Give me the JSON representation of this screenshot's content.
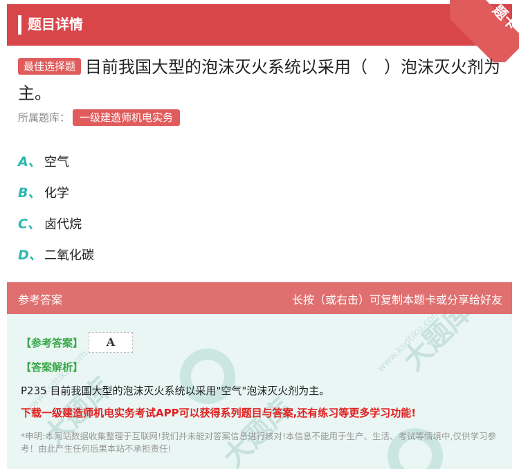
{
  "header": {
    "title": "题目详情",
    "corner_label": "题卡"
  },
  "question": {
    "tag": "最佳选择题",
    "text": "目前我国大型的泡沫灭火系统以采用（　）泡沫灭火剂为主。"
  },
  "bank": {
    "label": "所属题库：",
    "name": "一级建造师机电实务"
  },
  "options": [
    {
      "letter": "A、",
      "text": "空气"
    },
    {
      "letter": "B、",
      "text": "化学"
    },
    {
      "letter": "C、",
      "text": "卤代烷"
    },
    {
      "letter": "D、",
      "text": "二氧化碳"
    }
  ],
  "answer_section": {
    "title": "参考答案",
    "share_hint": "长按（或右击）可复制本题卡或分享给好友",
    "ref_label": "【参考答案】",
    "ref_value": "A",
    "analysis_label": "【答案解析】",
    "analysis": "P235 目前我国大型的泡沫灭火系统以采用\"空气\"泡沫灭火剂为主。",
    "promo": "下载一级建造师机电实务考试APP可以获得系列题目与答案,还有练习等更多学习功能!",
    "disclaimer": "*申明:本网站数据收集整理于互联网!我们并未能对答案信息进行核对!本信息不能用于生产、生活、考试等情境中,仅供学习参考！由此产生任何后果本站不承担责任!"
  },
  "colors": {
    "accent": "#d9464a",
    "option_letter": "#2bb8b0",
    "answer_green": "#3aa84b",
    "promo_red": "#e02020"
  }
}
